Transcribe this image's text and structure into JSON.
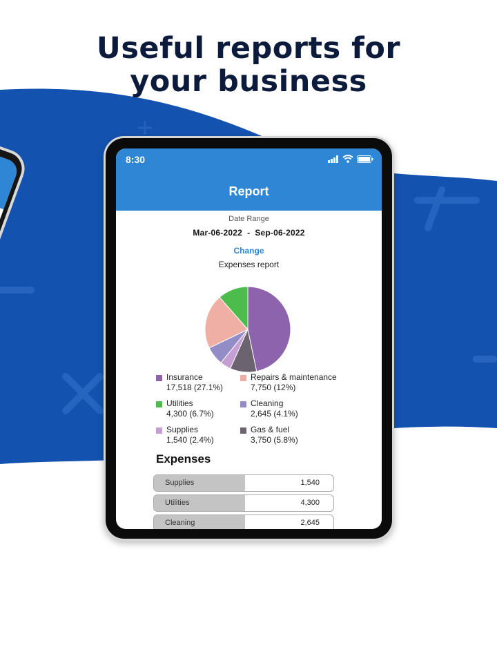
{
  "headline": {
    "line1": "Useful reports for",
    "line2": "your business"
  },
  "status_bar": {
    "time": "8:30"
  },
  "report": {
    "title": "Report",
    "date_range_label": "Date Range",
    "date_range_value": "Mar-06-2022  -  Sep-06-2022",
    "change_label": "Change",
    "chart_title": "Expenses report"
  },
  "chart_data": {
    "type": "pie",
    "title": "Expenses report",
    "slices": [
      {
        "name": "Insurance",
        "value": 17518,
        "percent": 27.1,
        "color": "#8e63ad"
      },
      {
        "name": "Gas & fuel",
        "value": 3750,
        "percent": 5.8,
        "color": "#6b6470"
      },
      {
        "name": "Supplies",
        "value": 1540,
        "percent": 2.4,
        "color": "#c59ed4"
      },
      {
        "name": "Cleaning",
        "value": 2645,
        "percent": 4.1,
        "color": "#928dc7"
      },
      {
        "name": "Repairs & maintenance",
        "value": 7750,
        "percent": 12,
        "color": "#f0afa4"
      },
      {
        "name": "Utilities",
        "value": 4300,
        "percent": 6.7,
        "color": "#4cbd4c"
      }
    ]
  },
  "legend": [
    {
      "name": "Insurance",
      "value": "17,518 (27.1%)",
      "color": "#8e63ad"
    },
    {
      "name": "Repairs & maintenance",
      "value": "7,750 (12%)",
      "color": "#f0afa4"
    },
    {
      "name": "Utilities",
      "value": "4,300 (6.7%)",
      "color": "#4cbd4c"
    },
    {
      "name": "Cleaning",
      "value": "2,645 (4.1%)",
      "color": "#928dc7"
    },
    {
      "name": "Supplies",
      "value": "1,540 (2.4%)",
      "color": "#c59ed4"
    },
    {
      "name": "Gas & fuel",
      "value": "3,750 (5.8%)",
      "color": "#6b6470"
    }
  ],
  "expenses": {
    "title": "Expenses",
    "rows": [
      {
        "name": "Supplies",
        "amount": "1,540"
      },
      {
        "name": "Utilities",
        "amount": "4,300"
      },
      {
        "name": "Cleaning",
        "amount": "2,645"
      }
    ]
  },
  "colors": {
    "brand_blue": "#2f86d5",
    "background_blue": "#1452b0",
    "headline": "#0c1b3c"
  }
}
